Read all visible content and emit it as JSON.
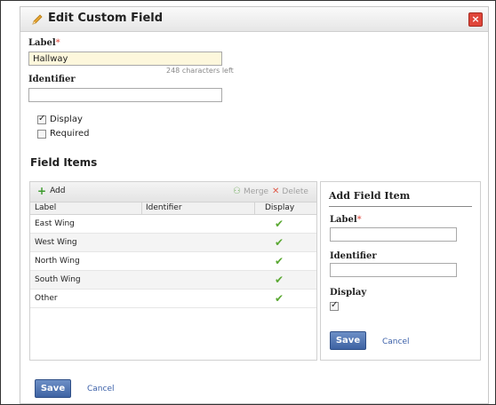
{
  "dialog": {
    "title": "Edit Custom Field",
    "close_icon": "close-icon",
    "title_icon": "pencil-icon"
  },
  "form": {
    "label_label": "Label",
    "required_mark": "*",
    "label_value": "Hallway",
    "chars_left": "248 characters left",
    "identifier_label": "Identifier",
    "identifier_value": "",
    "display_label": "Display",
    "display_checked": true,
    "required_label": "Required",
    "required_checked": false
  },
  "field_items": {
    "heading": "Field Items",
    "toolbar": {
      "add": "Add",
      "merge": "Merge",
      "delete": "Delete"
    },
    "columns": [
      "Label",
      "Identifier",
      "Display"
    ],
    "rows": [
      {
        "label": "East Wing",
        "identifier": "",
        "display": true
      },
      {
        "label": "West Wing",
        "identifier": "",
        "display": true
      },
      {
        "label": "North Wing",
        "identifier": "",
        "display": true
      },
      {
        "label": "South Wing",
        "identifier": "",
        "display": true
      },
      {
        "label": "Other",
        "identifier": "",
        "display": true
      }
    ]
  },
  "add_item": {
    "title": "Add Field Item",
    "label_label": "Label",
    "label_value": "",
    "identifier_label": "Identifier",
    "identifier_value": "",
    "display_label": "Display",
    "display_checked": true,
    "save": "Save",
    "cancel": "Cancel"
  },
  "footer": {
    "save": "Save",
    "cancel": "Cancel"
  },
  "colors": {
    "save_button": "#3e63a3",
    "check": "#5aa832",
    "required": "#e0463a",
    "close": "#e0463a"
  }
}
